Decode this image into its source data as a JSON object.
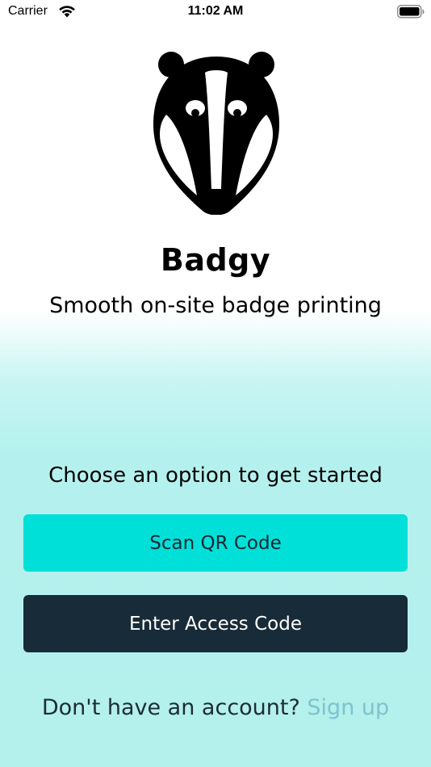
{
  "status_bar": {
    "carrier": "Carrier",
    "time": "11:02 AM"
  },
  "header": {
    "app_name": "Badgy",
    "tagline": "Smooth on-site badge printing"
  },
  "main": {
    "prompt": "Choose an option to get started",
    "scan_label": "Scan QR Code",
    "access_label": "Enter Access Code"
  },
  "footer": {
    "question": "Don't have an account?",
    "signup_label": "Sign up"
  },
  "colors": {
    "accent": "#00e0d8",
    "dark": "#182b38",
    "link": "#7cc4cf",
    "background_tint": "#b4f0ec"
  },
  "icons": {
    "logo": "badger-logo-icon",
    "wifi": "wifi-icon",
    "battery": "battery-icon"
  }
}
